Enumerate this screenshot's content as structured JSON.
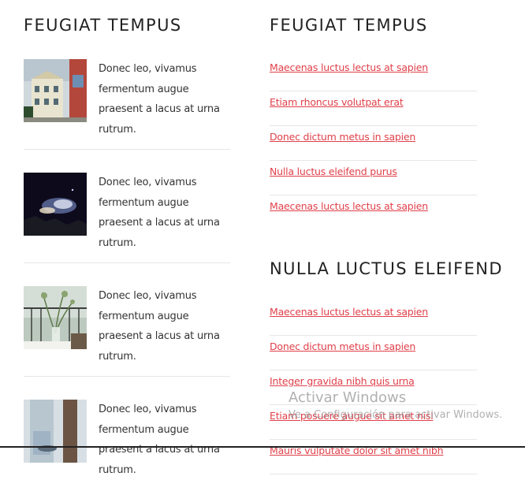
{
  "left": {
    "heading": "FEUGIAT TEMPUS",
    "posts": [
      {
        "text": "Donec leo, vivamus fermentum augue praesent a lacus at urna rutrum.",
        "image": "building-street-photo"
      },
      {
        "text": "Donec leo, vivamus fermentum augue praesent a lacus at urna rutrum.",
        "image": "night-smoke-photo"
      },
      {
        "text": "Donec leo, vivamus fermentum augue praesent a lacus at urna rutrum.",
        "image": "flowers-vase-photo"
      },
      {
        "text": "Donec leo, vivamus fermentum augue praesent a lacus at urna rutrum.",
        "image": "window-curtain-photo"
      }
    ]
  },
  "right": {
    "section1": {
      "heading": "FEUGIAT TEMPUS",
      "links": [
        "Maecenas luctus lectus at sapien",
        "Etiam rhoncus volutpat erat",
        "Donec dictum metus in sapien",
        "Nulla luctus eleifend purus",
        "Maecenas luctus lectus at sapien"
      ]
    },
    "section2": {
      "heading": "NULLA LUCTUS ELEIFEND",
      "links": [
        "Maecenas luctus lectus at sapien",
        "Donec dictum metus in sapien",
        "Integer gravida nibh quis urna",
        "Etiam posuere augue sit amet nisl",
        "Mauris vulputate dolor sit amet nibh"
      ]
    }
  },
  "watermark": {
    "title": "Activar Windows",
    "subtitle": "Ve a Configuración para activar Windows."
  },
  "colors": {
    "link": "#e0404a",
    "divider": "#e6e6e6",
    "heading": "#222222"
  }
}
